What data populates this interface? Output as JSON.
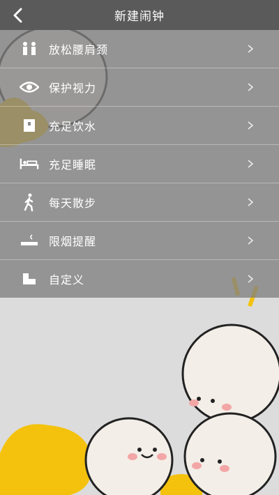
{
  "header": {
    "title": "新建闹钟",
    "back_icon": "chevron-left-icon"
  },
  "menu": {
    "items": [
      {
        "label": "放松腰肩颈",
        "icon": "people-icon"
      },
      {
        "label": "保护视力",
        "icon": "eye-icon"
      },
      {
        "label": "充足饮水",
        "icon": "water-dispenser-icon"
      },
      {
        "label": "充足睡眠",
        "icon": "bed-icon"
      },
      {
        "label": "每天散步",
        "icon": "walking-icon"
      },
      {
        "label": "限烟提醒",
        "icon": "cigarette-icon"
      },
      {
        "label": "自定义",
        "icon": "custom-shape-icon"
      }
    ]
  },
  "colors": {
    "header_bg": "#5a5a5a",
    "menu_bg": "#8a8a8a",
    "text": "#ffffff",
    "accent": "#f4c20d"
  }
}
